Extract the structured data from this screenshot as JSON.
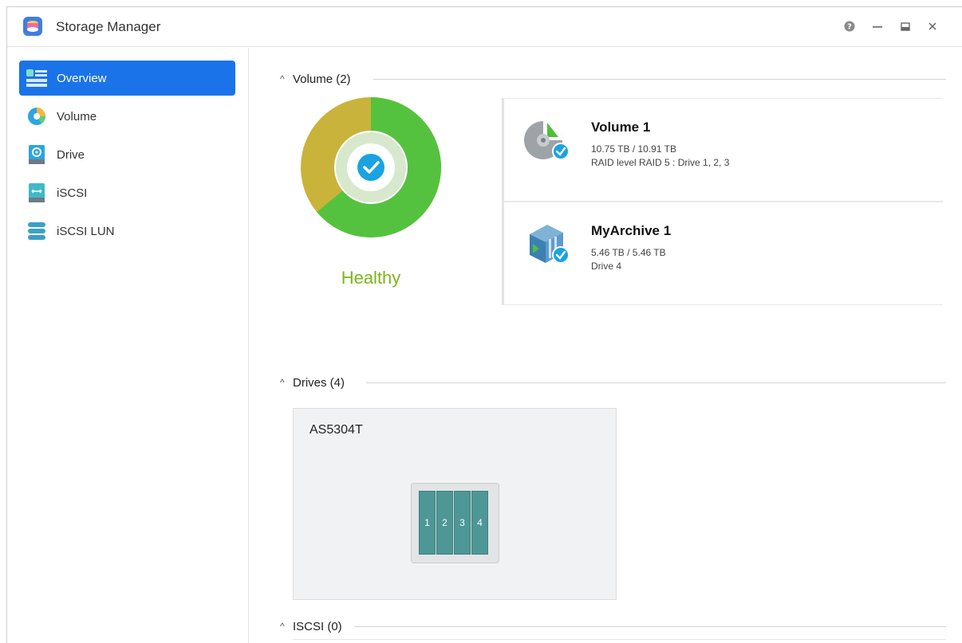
{
  "window": {
    "title": "Storage Manager",
    "icons": [
      "storage-app-icon",
      "help-icon",
      "minimize-icon",
      "maximize-icon",
      "close-icon"
    ]
  },
  "sidebar": {
    "items": [
      {
        "label": "Overview",
        "icon": "overview-icon",
        "active": true
      },
      {
        "label": "Volume",
        "icon": "volume-icon",
        "active": false
      },
      {
        "label": "Drive",
        "icon": "drive-icon",
        "active": false
      },
      {
        "label": "iSCSI",
        "icon": "iscsi-icon",
        "active": false
      },
      {
        "label": "iSCSI LUN",
        "icon": "iscsi-lun-icon",
        "active": false
      }
    ]
  },
  "main": {
    "volume_section": {
      "title": "Volume (2)",
      "status": "Healthy",
      "donut_share": {
        "used": 0.64,
        "other": 0.36
      },
      "colors": {
        "green": "#55c23f",
        "gold": "#c9b33a",
        "check": "#1aa3e0",
        "healthy_text": "#7cb518"
      },
      "volumes": [
        {
          "name": "Volume 1",
          "size": "10.75 TB / 10.91 TB",
          "detail": "RAID level RAID 5 : Drive 1, 2, 3",
          "icon": "volume-disk-icon"
        },
        {
          "name": "MyArchive 1",
          "size": "5.46 TB / 5.46 TB",
          "detail": "Drive 4",
          "icon": "archive-icon"
        }
      ]
    },
    "drives_section": {
      "title": "Drives (4)",
      "model": "AS5304T",
      "bays": [
        "1",
        "2",
        "3",
        "4"
      ]
    },
    "iscsi_section": {
      "title": "ISCSI (0)"
    }
  }
}
